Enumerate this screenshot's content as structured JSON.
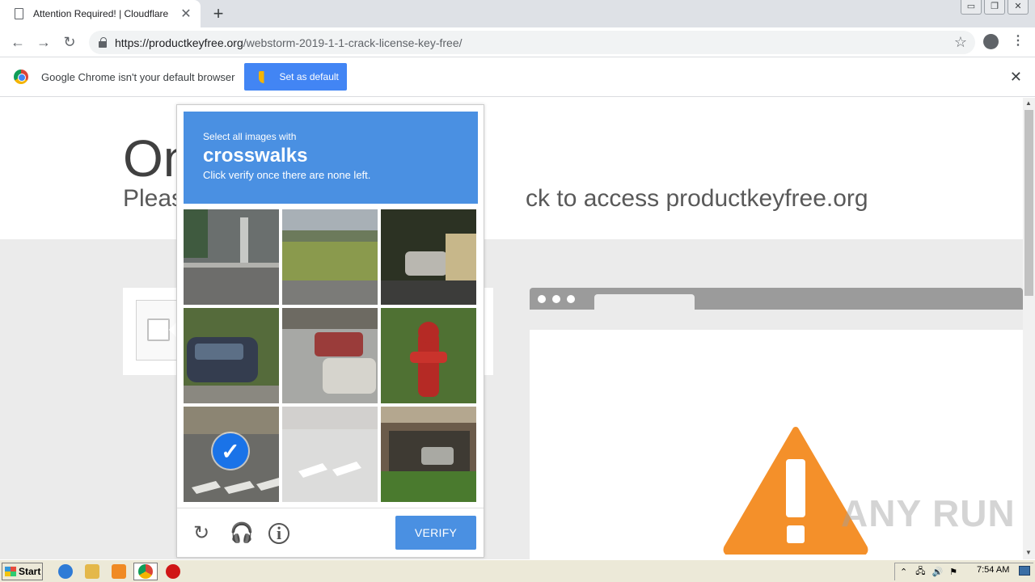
{
  "browser": {
    "tab_title": "Attention Required! | Cloudflare",
    "tab_close": "✕",
    "new_tab": "+",
    "url_host": "https://productkeyfree.org",
    "url_path": "/webstorm-2019-1-1-crack-license-key-free/",
    "window_controls": [
      "▭",
      "❐",
      "✕"
    ]
  },
  "infobar": {
    "message": "Google Chrome isn't your default browser",
    "button_label": "Set as default",
    "close": "✕"
  },
  "page": {
    "title_partial": "On",
    "subtitle_left": "Pleas",
    "subtitle_right": "ck to access productkeyfree.org"
  },
  "captcha": {
    "prompt_small": "Select all images with",
    "prompt_big": "crosswalks",
    "prompt_note": "Click verify once there are none left.",
    "verify_label": "VERIFY",
    "check_mark": "✓",
    "tiles": [
      {
        "name": "building-street"
      },
      {
        "name": "field-road"
      },
      {
        "name": "parked-car-dark"
      },
      {
        "name": "car-parked"
      },
      {
        "name": "cars-street"
      },
      {
        "name": "fire-hydrant"
      },
      {
        "name": "crosswalk",
        "selected": true
      },
      {
        "name": "crosswalk-faded",
        "faded": true
      },
      {
        "name": "building-car"
      }
    ]
  },
  "watermark": "ANY RUN",
  "taskbar": {
    "start_label": "Start",
    "clock": "7:54 AM"
  },
  "colors": {
    "accent": "#4a90e2",
    "chrome_blue": "#4285f4",
    "warning_orange": "#f4902a"
  }
}
